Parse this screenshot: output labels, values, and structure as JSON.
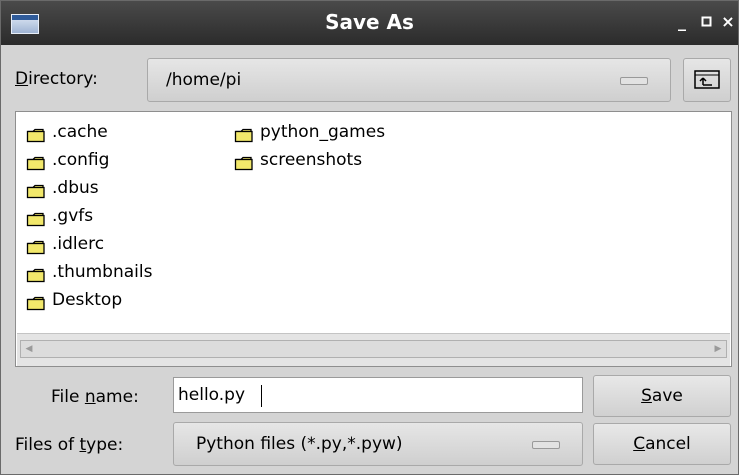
{
  "window": {
    "title": "Save As",
    "controls": {
      "minimize": "_",
      "maximize": "□",
      "close": "×"
    }
  },
  "directory": {
    "label_mnemonic": "D",
    "label_rest": "irectory:",
    "path": "/home/pi"
  },
  "files": {
    "column1": [
      ".cache",
      ".config",
      ".dbus",
      ".gvfs",
      ".idlerc",
      ".thumbnails",
      "Desktop"
    ],
    "column2": [
      "python_games",
      "screenshots"
    ],
    "icon": "folder-icon"
  },
  "filename": {
    "label_pre": "File ",
    "label_mnemonic": "n",
    "label_post": "ame:",
    "value": "hello.py"
  },
  "filetype": {
    "label_pre": "Files of ",
    "label_mnemonic": "t",
    "label_post": "ype:",
    "value": "Python files (*.py,*.pyw)"
  },
  "buttons": {
    "save_mnemonic": "S",
    "save_rest": "ave",
    "cancel_mnemonic": "C",
    "cancel_rest": "ancel"
  },
  "colors": {
    "titlebar": "#2b2b2b",
    "dialog_bg": "#d4d4d4",
    "folder_fill": "#f2e86b"
  }
}
